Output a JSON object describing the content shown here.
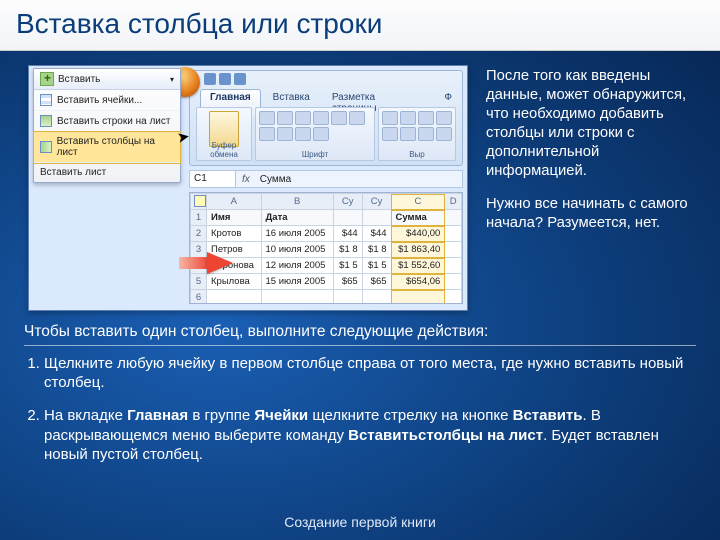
{
  "title": "Вставка столбца или строки",
  "menu": {
    "head": "Вставить",
    "items": [
      {
        "label": "Вставить ячейки..."
      },
      {
        "label": "Вставить строки на лист"
      },
      {
        "label": "Вставить столбцы на лист",
        "highlight": true
      },
      {
        "label": "Вставить лист"
      }
    ]
  },
  "ribbon": {
    "tabs": [
      "Главная",
      "Вставка",
      "Разметка страницы",
      "Ф"
    ],
    "groups": [
      "Буфер обмена",
      "Шрифт",
      "Выр"
    ],
    "paste": "Вставить"
  },
  "fbar": {
    "name": "C1",
    "fx": "fx",
    "val": "Сумма"
  },
  "sheet": {
    "cols": [
      "",
      "A",
      "B",
      "Су",
      "Су",
      "C",
      "D"
    ],
    "hdrRow": [
      "1",
      "Имя",
      "Дата",
      "",
      "",
      "Сумма",
      ""
    ],
    "rows": [
      [
        "2",
        "Кротов",
        "16 июля 2005",
        "$44",
        "$44",
        "$440,00",
        ""
      ],
      [
        "3",
        "Петров",
        "10 июля 2005",
        "$1 8",
        "$1 8",
        "$1 863,40",
        ""
      ],
      [
        "4",
        "Воронова",
        "12 июля 2005",
        "$1 5",
        "$1 5",
        "$1 552,60",
        ""
      ],
      [
        "5",
        "Крылова",
        "15 июля 2005",
        "$65",
        "$65",
        "$654,06",
        ""
      ],
      [
        "6",
        "",
        "",
        "",
        "",
        "",
        ""
      ]
    ]
  },
  "para1": "После того как введены данные, может обнаружится, что необходимо добавить столбцы или строки с дополнительной информацией.",
  "para2": "Нужно все начинать с самого начала? Разумеется, нет.",
  "subhead": "Чтобы вставить один столбец, выполните следующие действия:",
  "step1": "Щелкните любую ячейку в первом столбце справа от того места, где нужно вставить новый столбец.",
  "step2_a": "На вкладке ",
  "step2_b": "Главная",
  "step2_c": " в группе ",
  "step2_d": "Ячейки",
  "step2_e": " щелкните стрелку на кнопке ",
  "step2_f": "Вставить",
  "step2_g": ". В раскрывающемся меню выберите команду ",
  "step2_h": "Вставитьстолбцы на лист",
  "step2_i": ". Будет вставлен новый пустой столбец.",
  "footer": "Создание первой книги"
}
